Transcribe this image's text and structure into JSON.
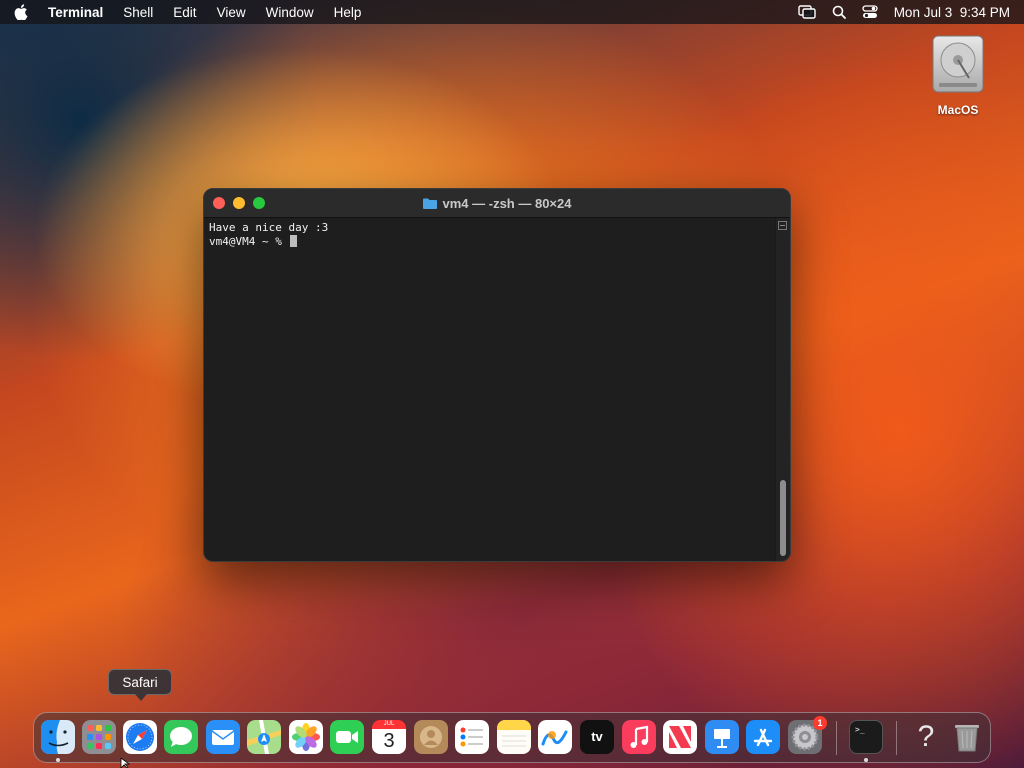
{
  "menubar": {
    "app": "Terminal",
    "items": [
      "Shell",
      "Edit",
      "View",
      "Window",
      "Help"
    ],
    "datetime": "Mon Jul 3  9:34 PM",
    "status_icons": [
      "screen-mirroring-icon",
      "search-icon",
      "control-center-icon"
    ]
  },
  "desktop": {
    "disk_label": "MacOS"
  },
  "terminal": {
    "title": "vm4 — -zsh — 80×24",
    "lines": [
      "Have a nice day :3",
      "vm4@VM4 ~ % "
    ]
  },
  "tooltip": {
    "text": "Safari"
  },
  "dock": {
    "items": [
      {
        "name": "finder",
        "color": "#2d8cf0"
      },
      {
        "name": "launchpad",
        "color": "#8e8e93"
      },
      {
        "name": "safari",
        "color": "#1e7cf2"
      },
      {
        "name": "messages",
        "color": "#34c759"
      },
      {
        "name": "mail",
        "color": "#2a8ff7"
      },
      {
        "name": "maps",
        "color": "#5ac363"
      },
      {
        "name": "photos",
        "color": "#ffffff"
      },
      {
        "name": "facetime",
        "color": "#2fcf55"
      },
      {
        "name": "calendar",
        "month": "JUL",
        "day": "3"
      },
      {
        "name": "contacts",
        "color": "#b58a5b"
      },
      {
        "name": "reminders",
        "color": "#ffffff"
      },
      {
        "name": "notes",
        "color": "#ffd54a"
      },
      {
        "name": "freeform",
        "color": "#ffffff"
      },
      {
        "name": "tv",
        "label": "tv"
      },
      {
        "name": "music",
        "color": "#fa3d5c"
      },
      {
        "name": "news",
        "color": "#f33a4f"
      },
      {
        "name": "keynote",
        "color": "#2f8cf2"
      },
      {
        "name": "app-store",
        "color": "#1d8df7"
      },
      {
        "name": "system-settings",
        "color": "#8e8e93",
        "badge": "1"
      },
      {
        "name": "terminal",
        "label": ">_"
      },
      {
        "name": "help",
        "label": "?"
      },
      {
        "name": "trash",
        "color": "#9a9a9a"
      }
    ]
  }
}
